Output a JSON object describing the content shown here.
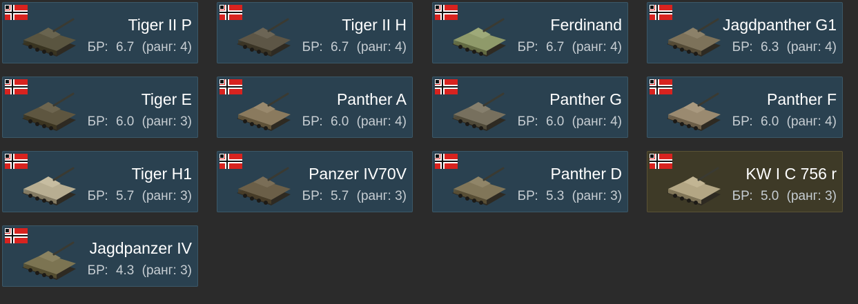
{
  "vehicles": [
    {
      "name": "Tiger II P",
      "br_label": "БР:",
      "br": "6.7",
      "rank_label": "ранг:",
      "rank": "4",
      "camo": "#5a5540",
      "premium": false
    },
    {
      "name": "Tiger II H",
      "br_label": "БР:",
      "br": "6.7",
      "rank_label": "ранг:",
      "rank": "4",
      "camo": "#5d5646",
      "premium": false
    },
    {
      "name": "Ferdinand",
      "br_label": "БР:",
      "br": "6.7",
      "rank_label": "ранг:",
      "rank": "4",
      "camo": "#8f9a6a",
      "premium": false
    },
    {
      "name": "Jagdpanther G1",
      "br_label": "БР:",
      "br": "6.3",
      "rank_label": "ранг:",
      "rank": "4",
      "camo": "#7d725a",
      "premium": false
    },
    {
      "name": "Tiger E",
      "br_label": "БР:",
      "br": "6.0",
      "rank_label": "ранг:",
      "rank": "3",
      "camo": "#5e5640",
      "premium": false
    },
    {
      "name": "Panther A",
      "br_label": "БР:",
      "br": "6.0",
      "rank_label": "ранг:",
      "rank": "4",
      "camo": "#8a7a5e",
      "premium": false
    },
    {
      "name": "Panther G",
      "br_label": "БР:",
      "br": "6.0",
      "rank_label": "ранг:",
      "rank": "4",
      "camo": "#77705e",
      "premium": false
    },
    {
      "name": "Panther F",
      "br_label": "БР:",
      "br": "6.0",
      "rank_label": "ранг:",
      "rank": "4",
      "camo": "#9a8a70",
      "premium": false
    },
    {
      "name": "Tiger H1",
      "br_label": "БР:",
      "br": "5.7",
      "rank_label": "ранг:",
      "rank": "3",
      "camo": "#b8ae92",
      "premium": false
    },
    {
      "name": "Panzer IV70V",
      "br_label": "БР:",
      "br": "5.7",
      "rank_label": "ранг:",
      "rank": "3",
      "camo": "#6b5f48",
      "premium": false
    },
    {
      "name": "Panther D",
      "br_label": "БР:",
      "br": "5.3",
      "rank_label": "ранг:",
      "rank": "3",
      "camo": "#817659",
      "premium": false
    },
    {
      "name": "KW I C 756 r",
      "br_label": "БР:",
      "br": "5.0",
      "rank_label": "ранг:",
      "rank": "3",
      "camo": "#b3a684",
      "premium": true
    },
    {
      "name": "Jagdpanzer IV",
      "br_label": "БР:",
      "br": "4.3",
      "rank_label": "ранг:",
      "rank": "3",
      "camo": "#7c7452",
      "premium": false
    }
  ],
  "colors": {
    "card_bg": "#2a4150",
    "card_premium_bg": "#3e3a27",
    "page_bg": "#2b2b2b",
    "flag_red": "#d8231f"
  },
  "icons": {
    "flag": "german-war-ensign-icon",
    "vehicle": "tank-thumbnail-icon"
  }
}
